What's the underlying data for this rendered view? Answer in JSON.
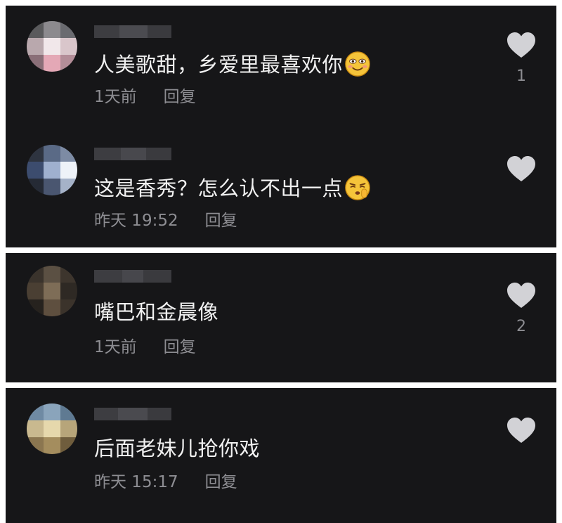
{
  "comments": [
    {
      "username": "",
      "text": "人美歌甜，乡爱里最喜欢你",
      "emoji": "smiling-face-emoji",
      "time": "1天前",
      "reply_label": "回复",
      "like_icon": "heart-icon",
      "like_count": "1"
    },
    {
      "username": "",
      "text": "这是香秀？怎么认不出一点",
      "emoji": "shushing-face-emoji",
      "time": "昨天 19:52",
      "reply_label": "回复",
      "like_icon": "heart-icon",
      "like_count": ""
    },
    {
      "username": "",
      "text": "嘴巴和金晨像",
      "emoji": "",
      "time": "1天前",
      "reply_label": "回复",
      "like_icon": "heart-icon",
      "like_count": "2"
    },
    {
      "username": "",
      "text": "后面老妹儿抢你戏",
      "emoji": "",
      "time": "昨天 15:17",
      "reply_label": "回复",
      "like_icon": "heart-icon",
      "like_count": ""
    }
  ],
  "colors": {
    "background": "#161618",
    "primary_text": "#f1f1f1",
    "secondary_text": "#8d8d92",
    "heart": "#d2d2d6",
    "emoji_yellow": "#f5c43a"
  }
}
